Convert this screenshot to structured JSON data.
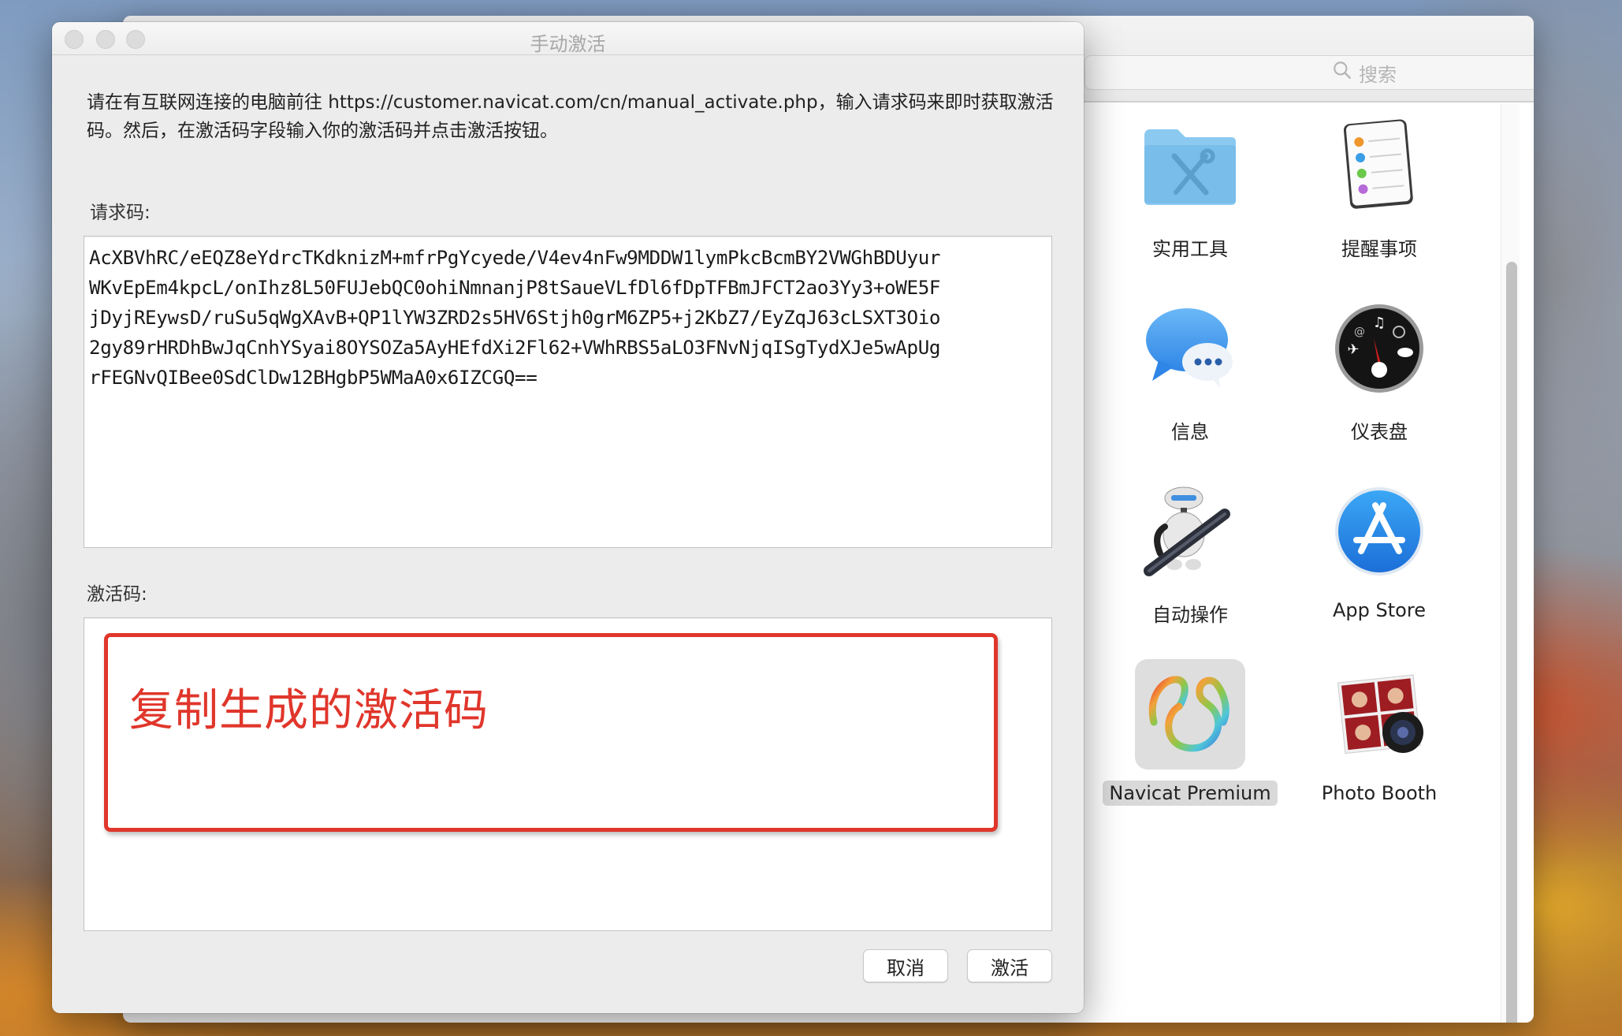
{
  "background_window": {
    "search": {
      "placeholder": "搜索",
      "icon": "search-icon"
    },
    "apps": [
      {
        "label": "实用工具",
        "icon": "utilities-folder-icon",
        "selected": false
      },
      {
        "label": "提醒事项",
        "icon": "reminders-icon",
        "selected": false
      },
      {
        "label": "信息",
        "icon": "messages-icon",
        "selected": false
      },
      {
        "label": "仪表盘",
        "icon": "dashboard-icon",
        "selected": false
      },
      {
        "label": "自动操作",
        "icon": "automator-icon",
        "selected": false
      },
      {
        "label": "App Store",
        "icon": "app-store-icon",
        "selected": false
      },
      {
        "label": "Navicat Premium",
        "icon": "navicat-icon",
        "selected": true
      },
      {
        "label": "Photo Booth",
        "icon": "photo-booth-icon",
        "selected": false
      }
    ]
  },
  "dialog": {
    "title": "手动激活",
    "instructions": "请在有互联网连接的电脑前往 https://customer.navicat.com/cn/manual_activate.php，输入请求码来即时获取激活码。然后，在激活码字段输入你的激活码并点击激活按钮。",
    "request_code_label": "请求码:",
    "request_code": "AcXBVhRC/eEQZ8eYdrcTKdknizM+mfrPgYcyede/V4ev4nFw9MDDW1lymPkcBcmBY2VWGhBDUyur\nWKvEpEm4kpcL/onIhz8L50FUJebQC0ohiNmnanjP8tSaueVLfDl6fDpTFBmJFCT2ao3Yy3+oWE5F\njDyjREywsD/ruSu5qWgXAvB+QP1lYW3ZRD2s5HV6Stjh0grM6ZP5+j2KbZ7/EyZqJ63cLSXT3Oio\n2gy89rHRDhBwJqCnhYSyai8OYSOZa5AyHEfdXi2Fl62+VWhRBS5aLO3FNvNjqISgTydXJe5wApUg\nrFEGNvQIBee0SdClDw12BHgbP5WMaA0x6IZCGQ==",
    "activation_code_label": "激活码:",
    "activation_code": "",
    "annotation": "复制生成的激活码",
    "annotation_color": "#e0362b",
    "buttons": {
      "cancel": "取消",
      "activate": "激活"
    }
  }
}
